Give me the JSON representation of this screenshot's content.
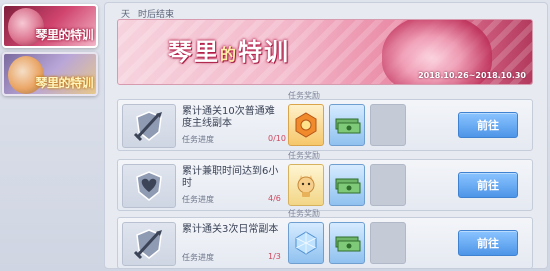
{
  "side_tabs": [
    {
      "label": "琴里的特训"
    },
    {
      "label": "琴里的特训"
    }
  ],
  "timer": {
    "days_value": "",
    "days_unit": "天",
    "hours_value": "",
    "suffix": "时后结束"
  },
  "banner": {
    "title_left": "琴里",
    "title_mid": "的",
    "title_right": "特训",
    "dates": "2018.10.26~2018.10.30"
  },
  "reward_header": "任务奖励",
  "progress_label": "任务进度",
  "go_label": "前往",
  "tasks": [
    {
      "desc": "累计通关10次普通难度主线副本",
      "progress": "0/10",
      "icon": "sword-shield-icon",
      "rewards": [
        {
          "icon": "orange-badge-icon",
          "tone": "orange"
        },
        {
          "icon": "cash-stack-icon",
          "tone": "blue"
        },
        {
          "icon": "",
          "tone": "empty"
        }
      ]
    },
    {
      "desc": "累计兼职时间达到6小时",
      "progress": "4/6",
      "icon": "heart-crest-icon",
      "rewards": [
        {
          "icon": "cat-figure-icon",
          "tone": "yellow"
        },
        {
          "icon": "cash-stack-icon",
          "tone": "blue"
        },
        {
          "icon": "",
          "tone": "empty"
        }
      ]
    },
    {
      "desc": "累计通关3次日常副本",
      "progress": "1/3",
      "icon": "sword-shield-icon",
      "rewards": [
        {
          "icon": "crystal-cube-icon",
          "tone": "blue"
        },
        {
          "icon": "cash-stack-icon",
          "tone": "blue"
        },
        {
          "icon": "",
          "tone": "empty"
        }
      ]
    }
  ],
  "colors": {
    "accent": "#4d95e8",
    "progress": "#d0475e",
    "banner_pink": "#e77d9c"
  }
}
